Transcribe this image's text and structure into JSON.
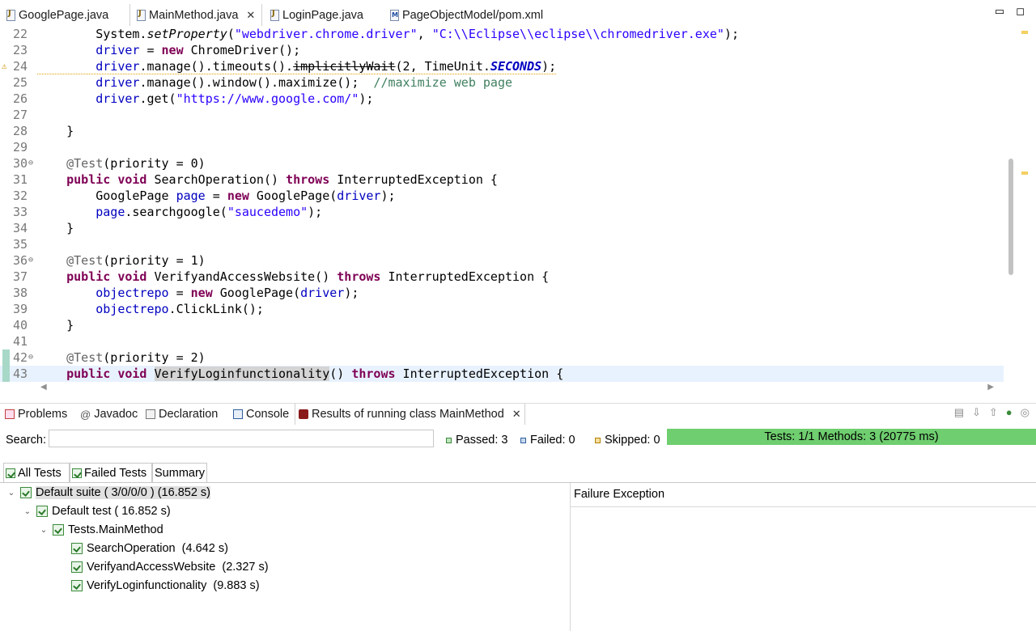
{
  "editor_tabs": [
    {
      "label": "GooglePage.java",
      "icon": "java-file-icon"
    },
    {
      "label": "MainMethod.java",
      "icon": "java-file-icon",
      "active": true
    },
    {
      "label": "LoginPage.java",
      "icon": "java-file-icon"
    },
    {
      "label": "PageObjectModel/pom.xml",
      "icon": "maven-file-icon"
    }
  ],
  "window_buttons": {
    "minimize": "▭",
    "maximize": "◻"
  },
  "code_lines": [
    {
      "n": "22",
      "text": "        System.setProperty(\"webdriver.chrome.driver\", \"C:\\\\Eclipse\\\\eclipse\\\\chromedriver.exe\");"
    },
    {
      "n": "23",
      "text": "        driver = new ChromeDriver();"
    },
    {
      "n": "24",
      "text": "        driver.manage().timeouts().implicitlyWait(2, TimeUnit.SECONDS);"
    },
    {
      "n": "25",
      "text": "        driver.manage().window().maximize();  //maximize web page"
    },
    {
      "n": "26",
      "text": "        driver.get(\"https://www.google.com/\");"
    },
    {
      "n": "27",
      "text": ""
    },
    {
      "n": "28",
      "text": "    }"
    },
    {
      "n": "29",
      "text": ""
    },
    {
      "n": "30",
      "text": "    @Test(priority = 0)"
    },
    {
      "n": "31",
      "text": "    public void SearchOperation() throws InterruptedException {"
    },
    {
      "n": "32",
      "text": "        GooglePage page = new GooglePage(driver);"
    },
    {
      "n": "33",
      "text": "        page.searchgoogle(\"saucedemo\");"
    },
    {
      "n": "34",
      "text": "    }"
    },
    {
      "n": "35",
      "text": ""
    },
    {
      "n": "36",
      "text": "    @Test(priority = 1)"
    },
    {
      "n": "37",
      "text": "    public void VerifyandAccessWebsite() throws InterruptedException {"
    },
    {
      "n": "38",
      "text": "        objectrepo = new GooglePage(driver);"
    },
    {
      "n": "39",
      "text": "        objectrepo.ClickLink();"
    },
    {
      "n": "40",
      "text": "    }"
    },
    {
      "n": "41",
      "text": ""
    },
    {
      "n": "42",
      "text": "    @Test(priority = 2)"
    },
    {
      "n": "43",
      "text": "    public void VerifyLoginfunctionality() throws InterruptedException {"
    }
  ],
  "view_tabs": [
    {
      "label": "Problems",
      "icon": "problems-icon"
    },
    {
      "label": "Javadoc",
      "icon": "javadoc-icon"
    },
    {
      "label": "Declaration",
      "icon": "declaration-icon"
    },
    {
      "label": "Console",
      "icon": "console-icon"
    },
    {
      "label": "Results of running class MainMethod",
      "icon": "testng-icon",
      "active": true
    }
  ],
  "search": {
    "label": "Search:",
    "value": ""
  },
  "counters": {
    "passed": "Passed: 3",
    "failed": "Failed: 0",
    "skipped": "Skipped: 0"
  },
  "progress": {
    "text": "Tests: 1/1  Methods: 3 (20775 ms)",
    "fraction": 1.0
  },
  "result_tabs": [
    "All Tests",
    "Failed Tests",
    "Summary"
  ],
  "tree": [
    {
      "label": "Default suite ( 3/0/0/0 ) (16.852 s)",
      "level": 0,
      "expanded": true,
      "selected": true
    },
    {
      "label": "Default test ( 16.852 s)",
      "level": 1,
      "expanded": true
    },
    {
      "label": "Tests.MainMethod",
      "level": 2,
      "expanded": true
    },
    {
      "label": "SearchOperation  (4.642 s)",
      "level": 3
    },
    {
      "label": "VerifyandAccessWebsite  (2.327 s)",
      "level": 3
    },
    {
      "label": "VerifyLoginfunctionality  (9.883 s)",
      "level": 3
    }
  ],
  "failure_title": "Failure Exception",
  "colors": {
    "progress": "#6fce6f",
    "keyword": "#7f0055",
    "string": "#2a00ff",
    "field": "#0000c0"
  }
}
